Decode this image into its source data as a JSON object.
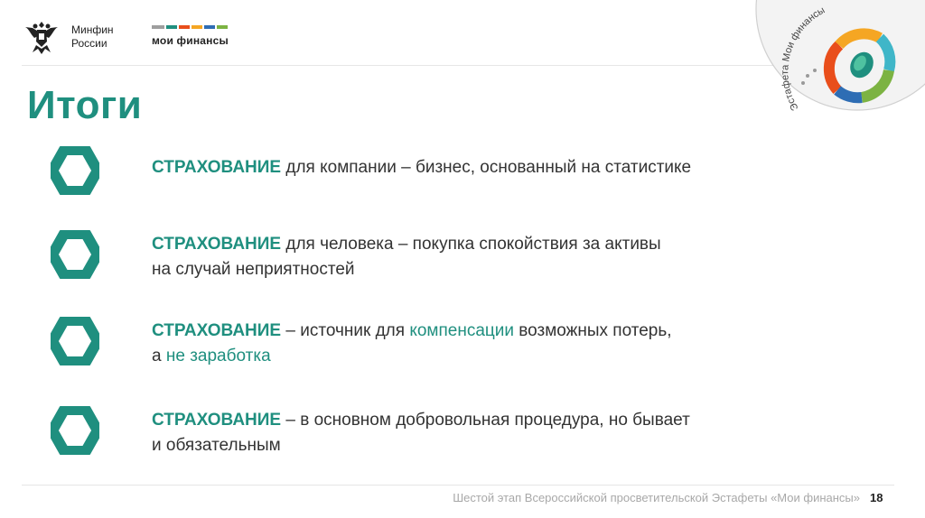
{
  "header": {
    "org_line1": "Минфин",
    "org_line2": "России",
    "program_name": "мои финансы",
    "badge_text": "Эстафета Мои финансы"
  },
  "title": "Итоги",
  "items": [
    {
      "keyword": "СТРАХОВАНИЕ",
      "line1_rest": " для компании – бизнес, основанный на статистике"
    },
    {
      "keyword": "СТРАХОВАНИЕ",
      "line1_rest": " для человека – покупка спокойствия за активы",
      "line2": "на случай неприятностей"
    },
    {
      "keyword": "СТРАХОВАНИЕ",
      "line1_mid": " – источник для ",
      "line1_highlight": "компенсации",
      "line1_end": " возможных потерь,",
      "line2_start": "а ",
      "line2_highlight": "не заработка"
    },
    {
      "keyword": "СТРАХОВАНИЕ",
      "line1_rest": " – в основном добровольная процедура, но бывает",
      "line2": "и обязательным"
    }
  ],
  "footer": {
    "text": "Шестой этап Всероссийской просветительской Эстафеты «Мои финансы»",
    "page_number": "18"
  },
  "colors": {
    "accent": "#1f8f7f",
    "text": "#333333",
    "footer_text": "#a8a8a8"
  },
  "icons": {
    "org_logo": "double-headed-eagle-icon",
    "bullet": "hexagon-icon"
  }
}
